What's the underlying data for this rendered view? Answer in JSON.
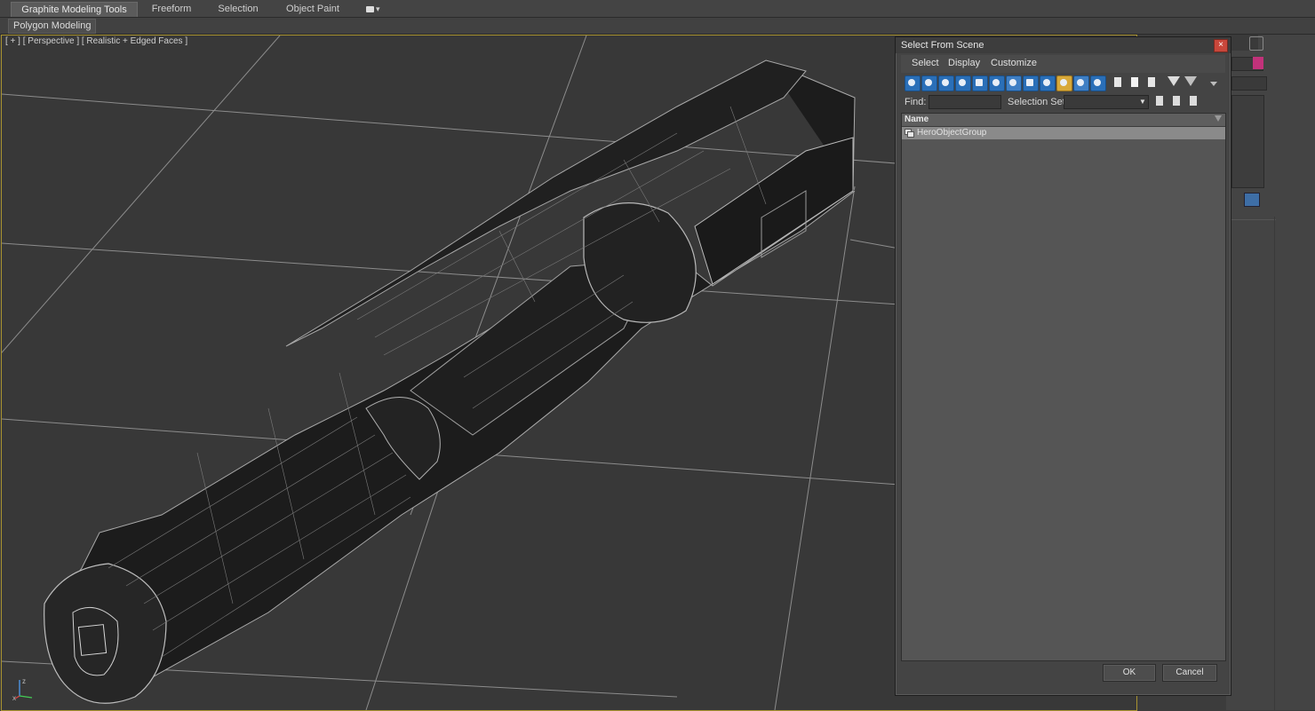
{
  "ribbon": {
    "tabs": [
      {
        "label": "Graphite Modeling Tools"
      },
      {
        "label": "Freeform"
      },
      {
        "label": "Selection"
      },
      {
        "label": "Object Paint"
      }
    ],
    "panel_label": "Polygon Modeling"
  },
  "viewport": {
    "label": "[ + ] [ Perspective ] [ Realistic + Edged Faces ]",
    "border_color": "#a89230",
    "axis_labels": {
      "z": "z",
      "x": "x"
    }
  },
  "dialog": {
    "title": "Select From Scene",
    "close_icon": "close-icon",
    "menu": [
      "Select",
      "Display",
      "Customize"
    ],
    "find_label": "Find:",
    "find_value": "",
    "selection_set_label": "Selection Set:",
    "selection_set_value": "",
    "column_header": "Name",
    "items": [
      {
        "name": "HeroObjectGroup",
        "icon": "group-icon",
        "selected": true
      }
    ],
    "ok_label": "OK",
    "cancel_label": "Cancel"
  },
  "colors": {
    "accent_blue": "#2a6fb8",
    "command_panel_swatch": "#c2327a"
  }
}
